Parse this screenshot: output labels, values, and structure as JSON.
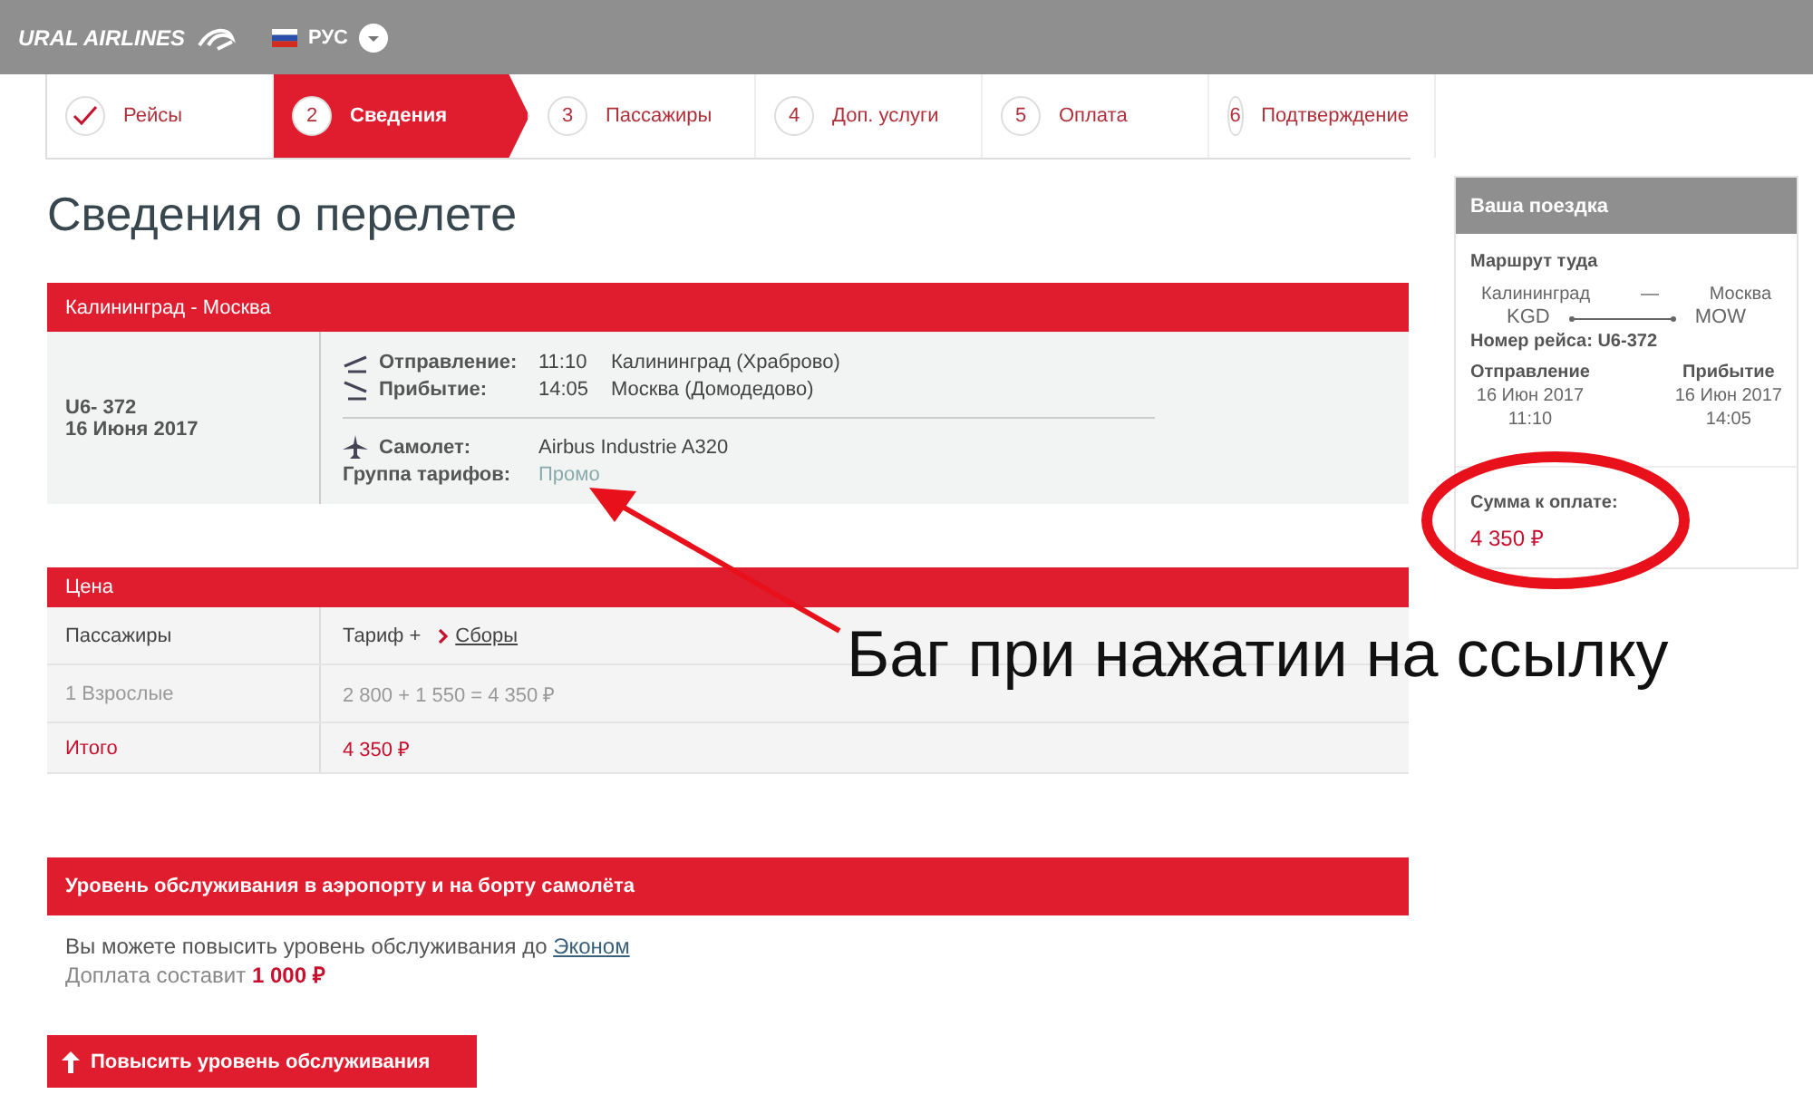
{
  "header": {
    "logo": "URAL AIRLINES",
    "language": "РУС"
  },
  "steps": [
    {
      "label": "Рейсы",
      "done": true,
      "selected": false
    },
    {
      "number": "2",
      "label": "Сведения",
      "done": false,
      "selected": true
    },
    {
      "number": "3",
      "label": "Пассажиры",
      "done": false,
      "selected": false
    },
    {
      "number": "4",
      "label": "Доп. услуги",
      "done": false,
      "selected": false
    },
    {
      "number": "5",
      "label": "Оплата",
      "done": false,
      "selected": false
    },
    {
      "number": "6",
      "label": "Подтверждение",
      "done": false,
      "selected": false
    }
  ],
  "page_title": "Сведения о перелете",
  "flight": {
    "route": "Калининград - Москва",
    "flight_number": "U6- 372",
    "date": "16 Июня 2017",
    "legs": [
      {
        "kind": "departure",
        "label": "Отправление:",
        "time": "11:10",
        "airport": "Калининград (Храброво)"
      },
      {
        "kind": "arrival",
        "label": "Прибытие:",
        "time": "14:05",
        "airport": "Москва (Домодедово)"
      }
    ],
    "aircraft_label": "Самолет:",
    "aircraft": "Airbus Industrie A320",
    "fare_group_label": "Группа тарифов:",
    "fare_group": "Промо"
  },
  "price": {
    "title": "Цена",
    "columns": [
      "Пассажиры",
      "Тариф +"
    ],
    "fees_link": "Сборы",
    "rows": [
      {
        "passengers": "1 Взрослые",
        "amount": "2 800 + 1 550 = 4 350 ₽"
      }
    ],
    "total_label": "Итого",
    "total": "4 350 ₽"
  },
  "service": {
    "title": "Уровень обслуживания в аэропорту и на борту самолёта",
    "text": "Вы можете повысить уровень обслуживания до",
    "link": "Эконом",
    "surcharge_label": "Доплата составит",
    "surcharge": "1 000 ₽",
    "button": "Повысить уровень обслуживания"
  },
  "trip": {
    "title": "Ваша поездка",
    "route_label": "Маршрут туда",
    "from_city": "Калининград",
    "dash": "—",
    "to_city": "Москва",
    "from_code": "KGD",
    "to_code": "MOW",
    "flight_number": "Номер рейса: U6-372",
    "departure_label": "Отправление",
    "departure_date": "16 Июн 2017",
    "departure_time": "11:10",
    "arrival_label": "Прибытие",
    "arrival_date": "16 Июн 2017",
    "arrival_time": "14:05",
    "sum_label": "Сумма к оплате:",
    "sum": "4 350 ₽"
  },
  "annotation": {
    "text": "Баг при нажатии на ссылку"
  }
}
